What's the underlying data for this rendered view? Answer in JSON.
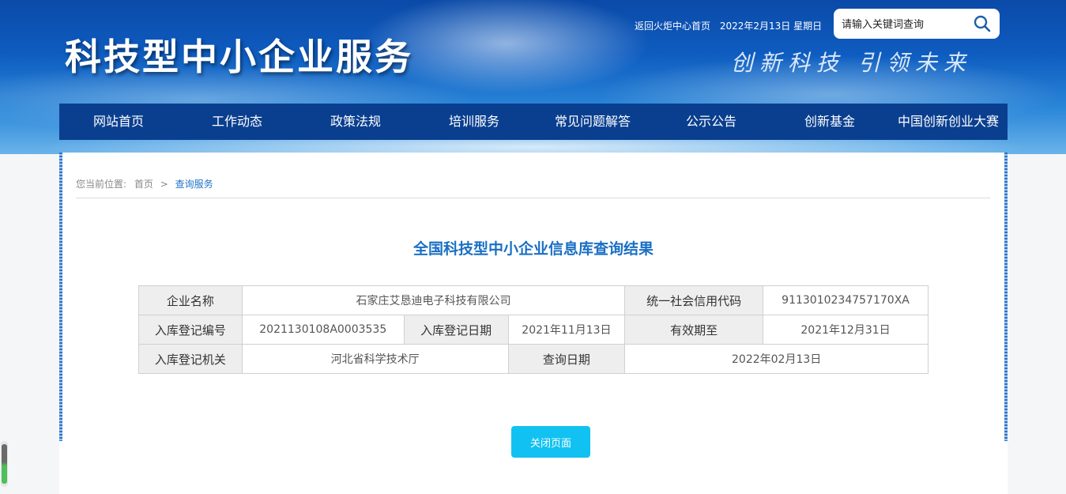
{
  "header": {
    "site_title": "科技型中小企业服务",
    "slogan": "创新科技  引领未来",
    "back_link": "返回火炬中心首页",
    "date": "2022年2月13日 星期日",
    "search": {
      "placeholder": "请输入关键词查询",
      "icon": "search-icon"
    }
  },
  "nav": {
    "items": [
      "网站首页",
      "工作动态",
      "政策法规",
      "培训服务",
      "常见问题解答",
      "公示公告",
      "创新基金",
      "中国创新创业大赛"
    ]
  },
  "breadcrumb": {
    "prefix": "您当前位置:",
    "home": "首页",
    "separator": ">",
    "current": "查询服务"
  },
  "result": {
    "title": "全国科技型中小企业信息库查询结果",
    "fields": {
      "company_name_label": "企业名称",
      "company_name": "石家庄艾恳迪电子科技有限公司",
      "credit_code_label": "统一社会信用代码",
      "credit_code": "9113010234757170XA",
      "reg_no_label": "入库登记编号",
      "reg_no": "2021130108A0003535",
      "reg_date_label": "入库登记日期",
      "reg_date": "2021年11月13日",
      "valid_until_label": "有效期至",
      "valid_until": "2021年12月31日",
      "authority_label": "入库登记机关",
      "authority": "河北省科学技术厅",
      "query_date_label": "查询日期",
      "query_date": "2022年02月13日"
    },
    "close_button": "关闭页面"
  },
  "colors": {
    "nav_bg": "#0a3f8f",
    "title_blue": "#1a6fc4",
    "button": "#11c1f2",
    "label_bg": "#eeeeee"
  }
}
